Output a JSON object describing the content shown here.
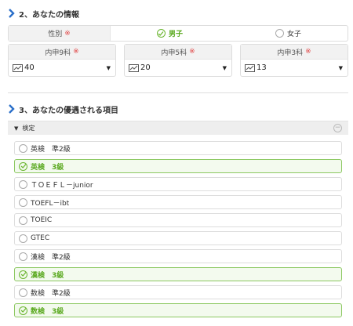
{
  "section2": {
    "title": "2、あなたの情報"
  },
  "gender": {
    "label": "性別",
    "required_mark": "※",
    "male": "男子",
    "female": "女子",
    "selected": "male"
  },
  "grades": [
    {
      "label": "内申9科",
      "required_mark": "※",
      "value": "40"
    },
    {
      "label": "内申5科",
      "required_mark": "※",
      "value": "20"
    },
    {
      "label": "内申3科",
      "required_mark": "※",
      "value": "13"
    }
  ],
  "section3": {
    "title": "3、あなたの優遇される項目"
  },
  "accordion": {
    "label": "検定",
    "collapse_icon": "minus-circle-icon"
  },
  "items": [
    {
      "label": "英検　準2級",
      "checked": false
    },
    {
      "label": "英検　3級",
      "checked": true
    },
    {
      "label": "ＴＯＥＦＬ－junior",
      "checked": false
    },
    {
      "label": "TOEFL－ibt",
      "checked": false
    },
    {
      "label": "TOEIC",
      "checked": false
    },
    {
      "label": "GTEC",
      "checked": false
    },
    {
      "label": "漢検　準2級",
      "checked": false
    },
    {
      "label": "漢検　3級",
      "checked": true
    },
    {
      "label": "数検　準2級",
      "checked": false
    },
    {
      "label": "数検　3級",
      "checked": true
    }
  ],
  "colors": {
    "accent_green": "#5aa91f",
    "required_red": "#e04545",
    "chevron_blue": "#2a6fc9"
  }
}
